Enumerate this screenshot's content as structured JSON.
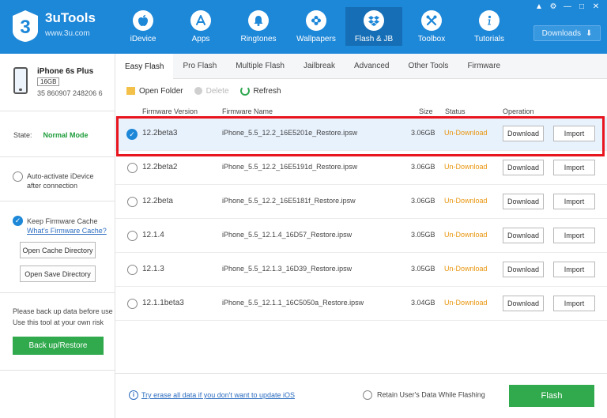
{
  "brand": {
    "name": "3uTools",
    "url": "www.3u.com",
    "logo_glyph": "3"
  },
  "nav": [
    {
      "label": "iDevice",
      "icon": "apple-icon"
    },
    {
      "label": "Apps",
      "icon": "app-store-icon"
    },
    {
      "label": "Ringtones",
      "icon": "bell-icon"
    },
    {
      "label": "Wallpapers",
      "icon": "flower-icon"
    },
    {
      "label": "Flash & JB",
      "icon": "dropbox-icon",
      "active": true
    },
    {
      "label": "Toolbox",
      "icon": "tools-icon"
    },
    {
      "label": "Tutorials",
      "icon": "info-icon"
    }
  ],
  "window_controls": [
    "shirt-icon",
    "gear-icon",
    "minimize-icon",
    "maximize-icon",
    "close-icon"
  ],
  "downloads": {
    "label": "Downloads"
  },
  "device": {
    "name": "iPhone 6s Plus",
    "capacity": "16GB",
    "serial": "35 860907 248206 6"
  },
  "state": {
    "label": "State:",
    "value": "Normal Mode"
  },
  "options": {
    "auto_activate": "Auto-activate iDevice after connection",
    "keep_cache": "Keep Firmware Cache",
    "cache_link": "What's Firmware Cache?",
    "open_cache": "Open Cache Directory",
    "open_save": "Open Save Directory"
  },
  "note": {
    "line1": "Please back up data before use",
    "line2": "Use this tool at your own risk"
  },
  "backup_button": "Back up/Restore",
  "tabs": [
    "Easy Flash",
    "Pro Flash",
    "Multiple Flash",
    "Jailbreak",
    "Advanced",
    "Other Tools",
    "Firmware"
  ],
  "toolbar": {
    "open_folder": "Open Folder",
    "delete": "Delete",
    "refresh": "Refresh"
  },
  "table": {
    "headers": {
      "version": "Firmware Version",
      "name": "Firmware Name",
      "size": "Size",
      "status": "Status",
      "operation": "Operation"
    },
    "rows": [
      {
        "version": "12.2beta3",
        "name": "iPhone_5.5_12.2_16E5201e_Restore.ipsw",
        "size": "3.06GB",
        "status": "Un-Download",
        "selected": true
      },
      {
        "version": "12.2beta2",
        "name": "iPhone_5.5_12.2_16E5191d_Restore.ipsw",
        "size": "3.06GB",
        "status": "Un-Download"
      },
      {
        "version": "12.2beta",
        "name": "iPhone_5.5_12.2_16E5181f_Restore.ipsw",
        "size": "3.06GB",
        "status": "Un-Download"
      },
      {
        "version": "12.1.4",
        "name": "iPhone_5.5_12.1.4_16D57_Restore.ipsw",
        "size": "3.05GB",
        "status": "Un-Download"
      },
      {
        "version": "12.1.3",
        "name": "iPhone_5.5_12.1.3_16D39_Restore.ipsw",
        "size": "3.05GB",
        "status": "Un-Download"
      },
      {
        "version": "12.1.1beta3",
        "name": "iPhone_5.5_12.1.1_16C5050a_Restore.ipsw",
        "size": "3.04GB",
        "status": "Un-Download"
      }
    ],
    "download_label": "Download",
    "import_label": "Import"
  },
  "footer": {
    "erase_link": "Try erase all data if you don't want to update iOS",
    "retain": "Retain User's Data While Flashing",
    "flash_button": "Flash"
  },
  "colors": {
    "header_blue": "#1d87d8",
    "green": "#31a94d",
    "status_orange": "#e8960f",
    "highlight_red": "#e8151f"
  }
}
